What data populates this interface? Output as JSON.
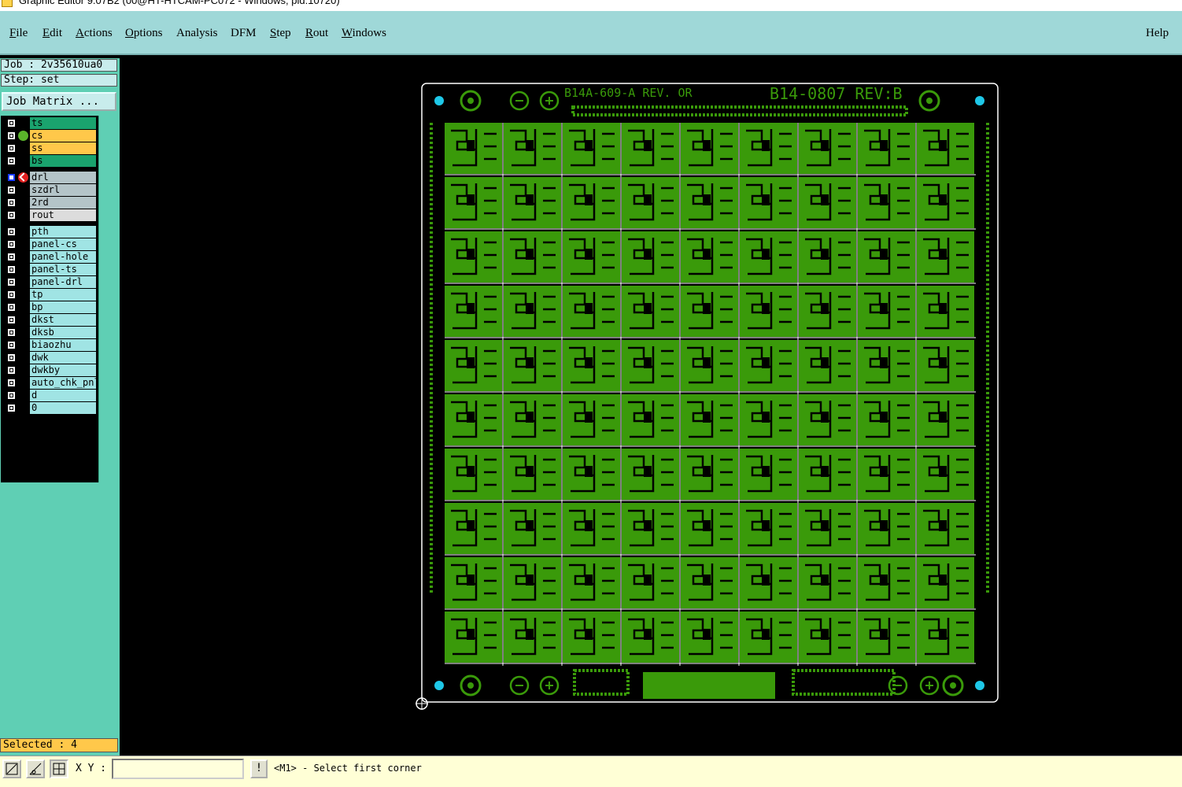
{
  "window": {
    "title": "Graphic Editor 9.07B2 (00@HT-HTCAM-PC072 - Windows, pid:10720)"
  },
  "menu": {
    "items": [
      {
        "label": "File",
        "underline": "F",
        "rest": "ile"
      },
      {
        "label": "Edit",
        "underline": "E",
        "rest": "dit"
      },
      {
        "label": "Actions",
        "underline": "A",
        "rest": "ctions"
      },
      {
        "label": "Options",
        "underline": "O",
        "rest": "ptions"
      },
      {
        "label": "Analysis",
        "underline": "",
        "rest": "Analysis"
      },
      {
        "label": "DFM",
        "underline": "",
        "rest": "DFM"
      },
      {
        "label": "Step",
        "underline": "S",
        "rest": "tep"
      },
      {
        "label": "Rout",
        "underline": "R",
        "rest": "out"
      },
      {
        "label": "Windows",
        "underline": "W",
        "rest": "indows"
      }
    ],
    "help": "Help"
  },
  "job": {
    "label": "Job : 2v35610ua0",
    "step": "Step: set",
    "matrix_button": "Job Matrix ..."
  },
  "layers": [
    {
      "name": "ts",
      "color": "#1aa36e",
      "mark": "",
      "checked": false
    },
    {
      "name": "cs",
      "color": "#ffc84a",
      "mark": "dot",
      "checked": false
    },
    {
      "name": "ss",
      "color": "#ffc84a",
      "mark": "",
      "checked": false
    },
    {
      "name": "bs",
      "color": "#1aa36e",
      "mark": "",
      "checked": false
    },
    {
      "name": "drl",
      "color": "#b4c4c8",
      "mark": "red",
      "checked": true,
      "gap": true
    },
    {
      "name": "szdrl",
      "color": "#b4c4c8",
      "mark": "",
      "checked": false
    },
    {
      "name": "2rd",
      "color": "#b4c4c8",
      "mark": "",
      "checked": false
    },
    {
      "name": "rout",
      "color": "#dcdcdc",
      "mark": "",
      "checked": false
    },
    {
      "name": "pth",
      "color": "#a0e4e4",
      "mark": "",
      "checked": false,
      "gap": true
    },
    {
      "name": "panel-cs",
      "color": "#a0e4e4",
      "mark": "",
      "checked": false
    },
    {
      "name": "panel-hole",
      "color": "#a0e4e4",
      "mark": "",
      "checked": false
    },
    {
      "name": "panel-ts",
      "color": "#a0e4e4",
      "mark": "",
      "checked": false
    },
    {
      "name": "panel-drl",
      "color": "#a0e4e4",
      "mark": "",
      "checked": false
    },
    {
      "name": "tp",
      "color": "#a0e4e4",
      "mark": "",
      "checked": false
    },
    {
      "name": "bp",
      "color": "#a0e4e4",
      "mark": "",
      "checked": false
    },
    {
      "name": "dkst",
      "color": "#a0e4e4",
      "mark": "",
      "checked": false
    },
    {
      "name": "dksb",
      "color": "#a0e4e4",
      "mark": "",
      "checked": false
    },
    {
      "name": "biaozhu",
      "color": "#a0e4e4",
      "mark": "",
      "checked": false
    },
    {
      "name": "dwk",
      "color": "#a0e4e4",
      "mark": "",
      "checked": false
    },
    {
      "name": "dwkby",
      "color": "#a0e4e4",
      "mark": "",
      "checked": false
    },
    {
      "name": "auto_chk_pnl",
      "color": "#a0e4e4",
      "mark": "",
      "checked": false
    },
    {
      "name": "d",
      "color": "#a0e4e4",
      "mark": "",
      "checked": false
    },
    {
      "name": "0",
      "color": "#a0e4e4",
      "mark": "",
      "checked": false
    }
  ],
  "status": {
    "selected": "Selected : 4",
    "xy_label": "X Y :",
    "xy_value": "",
    "bang": "!",
    "prompt": "<M1> - Select first corner"
  },
  "board": {
    "label_left": "B14A-609-A  REV. OR",
    "label_right": "B14-0807  REV:B",
    "rows": 10,
    "cols": 9,
    "copper_color": "#3a9a0a",
    "fiducial_color": "#1ec8e8"
  }
}
